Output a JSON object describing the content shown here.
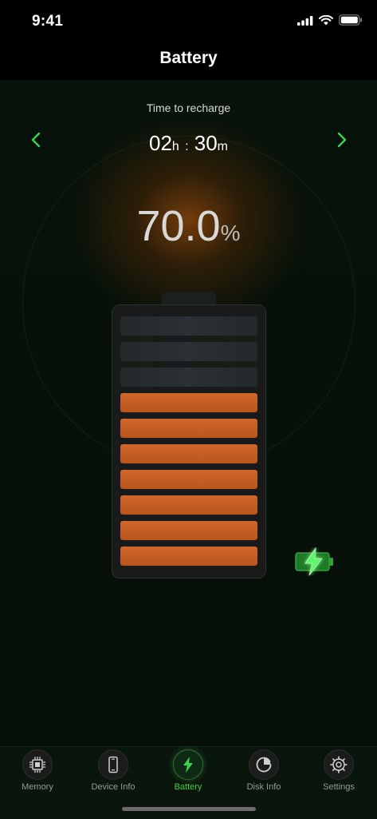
{
  "status_bar": {
    "time": "9:41",
    "icons": [
      "signal-icon",
      "wifi-icon",
      "battery-status-icon"
    ]
  },
  "header": {
    "title": "Battery"
  },
  "recharge": {
    "label": "Time to recharge",
    "hours": "02",
    "hours_unit": "h",
    "separator": ":",
    "minutes": "30",
    "minutes_unit": "m",
    "prev_icon": "chevron-left-icon",
    "next_icon": "chevron-right-icon"
  },
  "battery": {
    "percent_value": "70.0",
    "percent_sign": "%",
    "level": 0.7,
    "total_cells": 10,
    "filled_cells": 7,
    "charging": true,
    "charging_icon": "charging-battery-icon"
  },
  "colors": {
    "accent": "#3fd24c",
    "cell_full": "#c65e24",
    "cell_empty": "#272c2e",
    "background": "#07120a"
  },
  "tabs": [
    {
      "label": "Memory",
      "icon": "chip-icon",
      "active": false
    },
    {
      "label": "Device Info",
      "icon": "phone-icon",
      "active": false
    },
    {
      "label": "Battery",
      "icon": "lightning-icon",
      "active": true
    },
    {
      "label": "Disk Info",
      "icon": "disk-icon",
      "active": false
    },
    {
      "label": "Settings",
      "icon": "gear-icon",
      "active": false
    }
  ]
}
